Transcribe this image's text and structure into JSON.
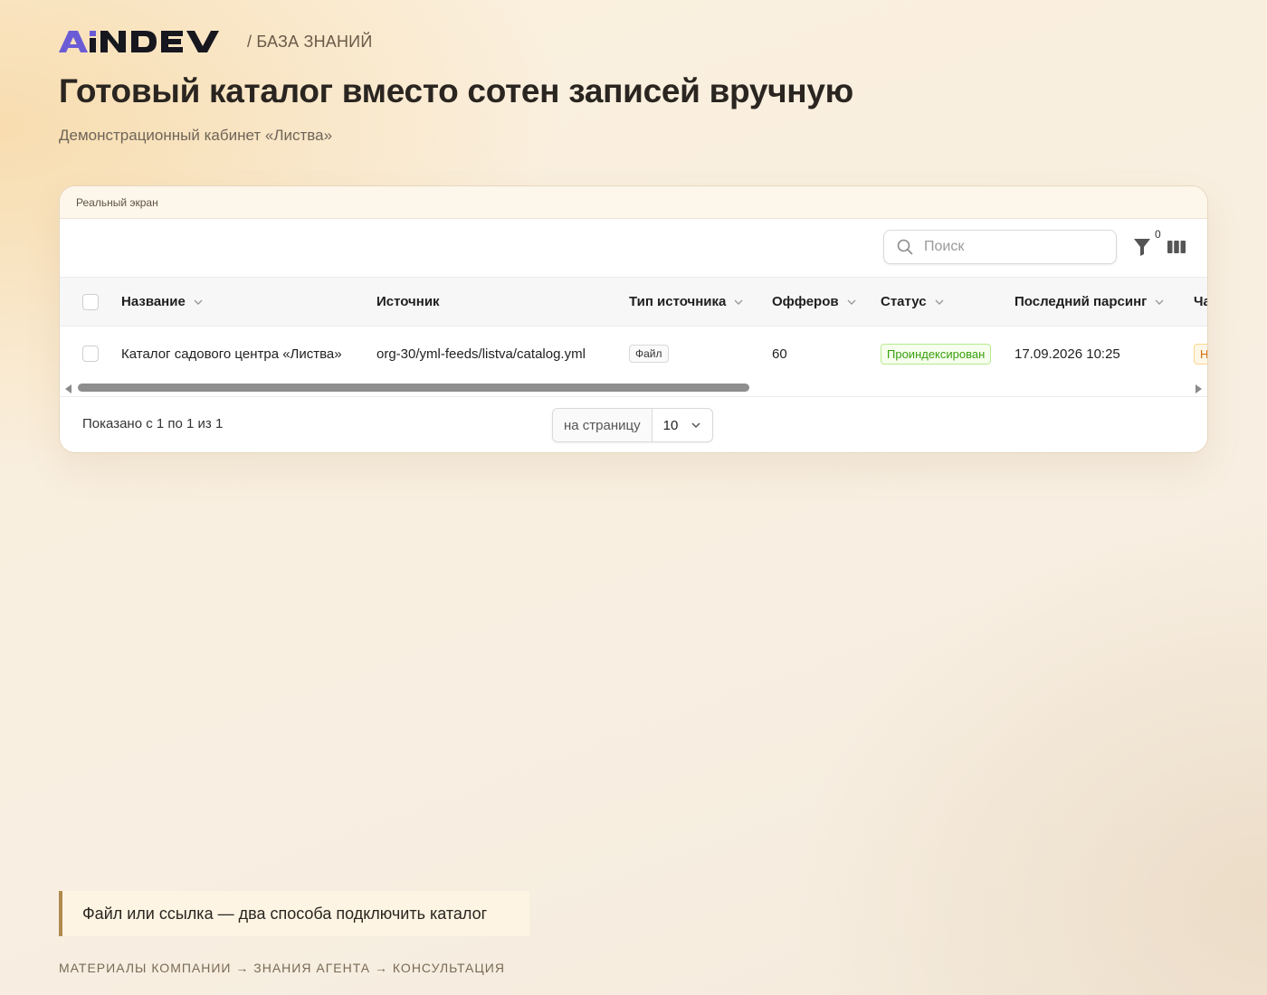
{
  "header": {
    "brand": "AiNDEV",
    "section": "/ БАЗА ЗНАНИЙ",
    "title": "Готовый каталог вместо сотен записей вручную",
    "subtitle": "Демонстрационный кабинет «Листва»"
  },
  "screen": {
    "caption": "Реальный экран",
    "toolbar": {
      "search_placeholder": "Поиск",
      "search_value": "",
      "filter_count": "0"
    },
    "table": {
      "columns": {
        "name": "Название",
        "source": "Источник",
        "source_type": "Тип источника",
        "offers": "Офферов",
        "status": "Статус",
        "last_parse": "Последний парсинг",
        "next_partial": "Ча"
      },
      "rows": [
        {
          "name": "Каталог садового центра «Листва»",
          "source": "org-30/yml-feeds/listva/catalog.yml",
          "source_type": "Файл",
          "offers": "60",
          "status": "Проиндексирован",
          "last_parse": "17.09.2026 10:25",
          "next_partial": "Н"
        }
      ]
    },
    "footer": {
      "shown": "Показано с 1 по 1 из 1",
      "per_page_label": "на страницу",
      "per_page_value": "10"
    }
  },
  "callout": "Файл или ссылка — два способа подключить каталог",
  "breadcrumb": "МАТЕРИАЛЫ КОМПАНИИ → ЗНАНИЯ АГЕНТА → КОНСУЛЬТАЦИЯ",
  "colors": {
    "logo_accent": "#6b5cd6",
    "logo_dark": "#17171f",
    "status_green": "#389e0d",
    "callout_border": "#b08a4e"
  }
}
